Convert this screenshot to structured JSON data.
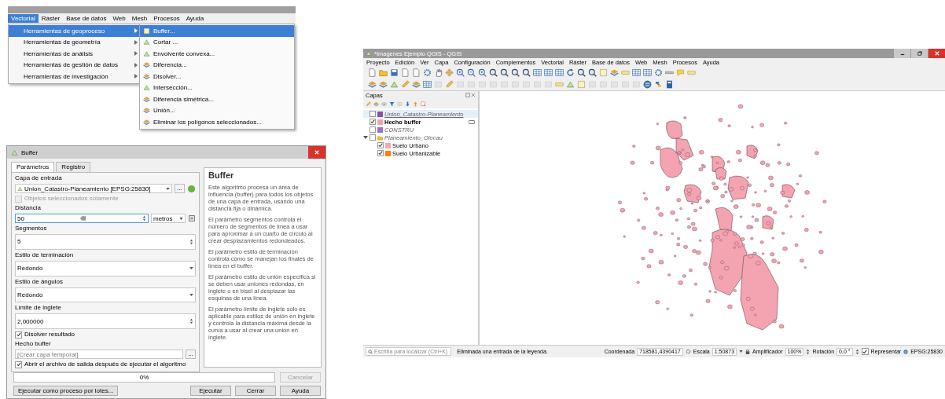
{
  "menu_shot": {
    "menubar": [
      {
        "label": "Vectorial",
        "selected": true
      },
      {
        "label": "Ráster",
        "selected": false
      },
      {
        "label": "Base de datos",
        "selected": false
      },
      {
        "label": "Web",
        "selected": false
      },
      {
        "label": "Mesh",
        "selected": false
      },
      {
        "label": "Procesos",
        "selected": false
      },
      {
        "label": "Ayuda",
        "selected": false
      }
    ],
    "dropdown": [
      {
        "label": "Herramientas de geoproceso",
        "selected": true
      },
      {
        "label": "Herramientas de geometría",
        "selected": false
      },
      {
        "label": "Herramientas de análisis",
        "selected": false
      },
      {
        "label": "Herramientas de gestión de datos",
        "selected": false
      },
      {
        "label": "Herramientas de investigación",
        "selected": false
      }
    ],
    "submenu": [
      {
        "label": "Buffer...",
        "selected": true
      },
      {
        "label": "Cortar ...",
        "selected": false
      },
      {
        "label": "Envolvente convexa...",
        "selected": false
      },
      {
        "label": "Diferencia...",
        "selected": false
      },
      {
        "label": "Disolver...",
        "selected": false
      },
      {
        "label": "Intersección...",
        "selected": false
      },
      {
        "label": "Diferencia simétrica...",
        "selected": false
      },
      {
        "label": "Unión...",
        "selected": false
      },
      {
        "label": "Eliminar los polígonos seleccionados...",
        "selected": false
      }
    ]
  },
  "buffer_dialog": {
    "title": "Buffer",
    "tabs": [
      {
        "label": "Parámetros",
        "selected": true
      },
      {
        "label": "Registro",
        "selected": false
      }
    ],
    "fields": [
      {
        "kind": "label",
        "text": "Capa de entrada"
      },
      {
        "kind": "layer_combo",
        "value": "Union_Catastro-Planeamiento [EPSG:25830]",
        "button": "..."
      },
      {
        "kind": "checkbox",
        "label": "Objetos seleccionados solamente",
        "checked": false,
        "disabled": true
      },
      {
        "kind": "label",
        "text": "Distancia"
      },
      {
        "kind": "distance",
        "value": "50",
        "unit": "metros"
      },
      {
        "kind": "label",
        "text": "Segmentos"
      },
      {
        "kind": "spin",
        "value": "5"
      },
      {
        "kind": "label",
        "text": "Estilo de terminación"
      },
      {
        "kind": "combo",
        "value": "Redondo"
      },
      {
        "kind": "label",
        "text": "Estilo de ángulos"
      },
      {
        "kind": "combo",
        "value": "Redondo"
      },
      {
        "kind": "label",
        "text": "Límite de inglete"
      },
      {
        "kind": "spin",
        "value": "2,000000"
      },
      {
        "kind": "checkbox",
        "label": "Disolver resultado",
        "checked": true,
        "disabled": false
      },
      {
        "kind": "label",
        "text": "Hecho buffer"
      },
      {
        "kind": "output",
        "placeholder": "[Crear capa temporal]",
        "button": "..."
      },
      {
        "kind": "checkbox",
        "label": "Abrir el archivo de salida después de ejecutar el algoritmo",
        "checked": true,
        "disabled": false
      }
    ],
    "help": {
      "title": "Buffer",
      "paragraphs": [
        "Este algoritmo procesa un área de influencia (buffer) para todos los objetos de una capa de entrada, usando una distancia fija o dinámica.",
        "El parámetro segmentos controla el número de segmentos de línea a usar para aproximar a un cuarto de círculo al crear desplazamientos redondeados.",
        "El parámetro estilo de terminación controla cómo se manejan los finales de línea en el buffer.",
        "El parámetro estilo de unión especifica si se deben usar uniones redondas, en inglete o en bisel al desplazar las esquinas de una línea.",
        "El parámetro límite de inglete solo es aplicable para estilos de unión en inglete y controla la distancia máxima desde la curva a usar al crear una unión en inglete."
      ]
    },
    "progress": {
      "label": "0%",
      "level": 0
    },
    "cancel": {
      "label": "Cancelar",
      "disabled": true
    },
    "batch_button": "Ejecutar como proceso por lotes...",
    "buttons": [
      "Ejecutar",
      "Cerrar",
      "Ayuda"
    ]
  },
  "qgis_window": {
    "title": "*Imagenes Ejemplo QGIS - QGIS",
    "menu": [
      "Proyecto",
      "Edición",
      "Ver",
      "Capa",
      "Configuración",
      "Complementos",
      "Vectorial",
      "Ráster",
      "Base de datos",
      "Web",
      "Mesh",
      "Procesos",
      "Ayuda"
    ],
    "layers_panel": {
      "title": "Capas",
      "layers": [
        {
          "kind": "layer",
          "name": "Union_Catastro-Planeamiento",
          "checked": false,
          "selected": true,
          "bold": false,
          "color": "#8e4fa3"
        },
        {
          "kind": "layer",
          "name": "Hecho buffer",
          "checked": true,
          "selected": false,
          "bold": true,
          "color": "#f0a3b3"
        },
        {
          "kind": "layer",
          "name": "CONSTRU",
          "checked": false,
          "selected": false,
          "bold": false,
          "color": "#9b6fc4"
        },
        {
          "kind": "group",
          "name": "Planeamiento_Olocau",
          "checked": false,
          "selected": false,
          "bold": false,
          "expanded": true,
          "children": [
            {
              "kind": "layer",
              "name": "Suelo Urbano",
              "checked": true,
              "selected": false,
              "bold": false,
              "color": "#f4a7b5"
            },
            {
              "kind": "layer",
              "name": "Suelo Urbanizable",
              "checked": true,
              "selected": false,
              "bold": false,
              "color": "#ff8000"
            }
          ]
        }
      ]
    },
    "status_bar": {
      "search_placeholder": "Escriba para localizar (Ctrl+K)",
      "message": "Eliminada una entrada de la leyenda.",
      "coordinate_label": "Coordenada",
      "coordinate": "718581,4390417",
      "scale_label": "Escala",
      "scale": "1:50873",
      "magnifier_label": "Amplificador",
      "magnifier": "100%",
      "rotation_label": "Rotación",
      "rotation": "0,0 °",
      "render": {
        "label": "Representar",
        "checked": true
      },
      "crs": "EPSG:25830"
    }
  }
}
